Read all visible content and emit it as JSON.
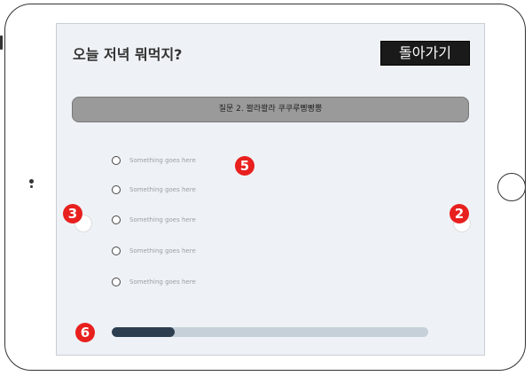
{
  "header": {
    "title": "오늘 저녁 뭐먹지?",
    "back_label": "돌아가기"
  },
  "question": {
    "text": "질문 2. 쏼라쏼라 쿠쿠루삥빵뽕"
  },
  "options": [
    {
      "label": "Something goes here"
    },
    {
      "label": "Something goes here"
    },
    {
      "label": "Something goes here"
    },
    {
      "label": "Something goes here"
    },
    {
      "label": "Something goes here"
    }
  ],
  "markers": {
    "m5": "5",
    "m3": "3",
    "m2": "2",
    "m6": "6"
  },
  "progress": {
    "fraction": 0.2
  },
  "colors": {
    "marker": "#e8201e",
    "progress_fill": "#2c3e50",
    "progress_track": "#c5d0d8"
  }
}
